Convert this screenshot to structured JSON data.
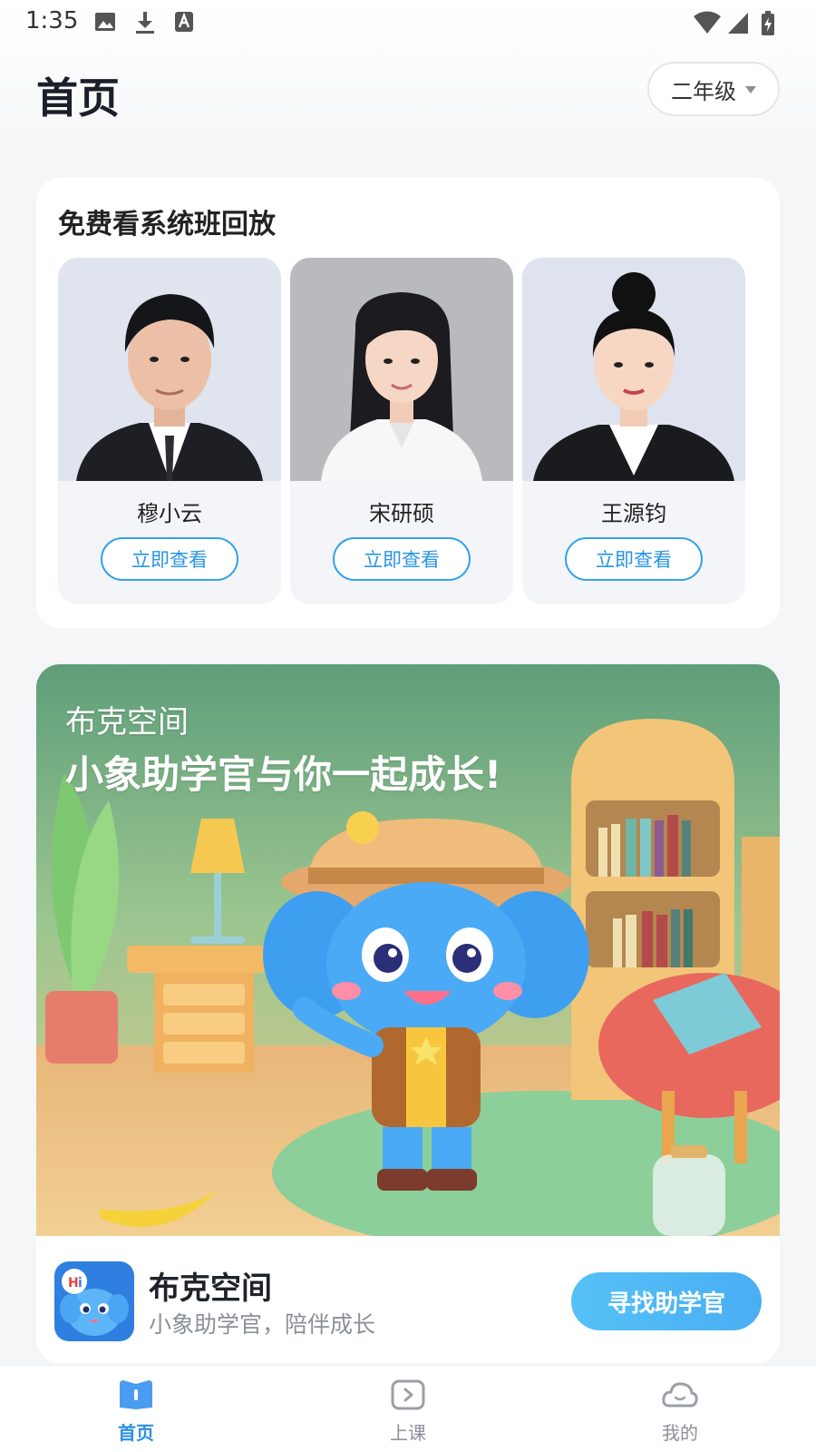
{
  "status_bar": {
    "time": "1:35"
  },
  "header": {
    "title": "首页",
    "grade": "二年级"
  },
  "replay": {
    "title": "免费看系统班回放",
    "teachers": [
      {
        "name": "穆小云",
        "button": "立即查看"
      },
      {
        "name": "宋研硕",
        "button": "立即查看"
      },
      {
        "name": "王源钧",
        "button": "立即查看"
      }
    ]
  },
  "banner": {
    "kicker": "布克空间",
    "headline": "小象助学官与你一起成长!",
    "app_name": "布克空间",
    "app_subtitle": "小象助学官，陪伴成长",
    "cta": "寻找助学官"
  },
  "nav": {
    "items": [
      {
        "label": "首页",
        "icon": "book-icon",
        "active": true
      },
      {
        "label": "上课",
        "icon": "play-icon",
        "active": false
      },
      {
        "label": "我的",
        "icon": "cloud-face-icon",
        "active": false
      }
    ]
  },
  "colors": {
    "accent": "#2b8fe6",
    "button_outline": "#34a3ec",
    "cta_gradient": "#55c1f6"
  }
}
